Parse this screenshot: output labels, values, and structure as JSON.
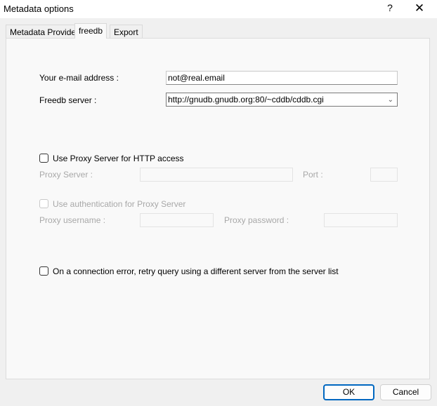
{
  "window": {
    "title": "Metadata options",
    "help": "?",
    "close": "✕"
  },
  "tabs": [
    {
      "label": "Metadata Provider"
    },
    {
      "label": "freedb"
    },
    {
      "label": "Export"
    }
  ],
  "freedb": {
    "email_label": "Your e-mail address :",
    "email_value": "not@real.email",
    "server_label": "Freedb server :",
    "server_value": "http://gnudb.gnudb.org:80/~cddb/cddb.cgi",
    "use_proxy_label": "Use Proxy Server for HTTP access",
    "proxy_server_label": "Proxy Server :",
    "proxy_server_value": "",
    "port_label": "Port :",
    "port_value": "",
    "use_auth_label": "Use authentication for Proxy Server",
    "proxy_username_label": "Proxy username :",
    "proxy_username_value": "",
    "proxy_password_label": "Proxy password :",
    "proxy_password_value": "",
    "retry_label": "On a connection error, retry query using a different server from the server list"
  },
  "buttons": {
    "ok": "OK",
    "cancel": "Cancel"
  }
}
